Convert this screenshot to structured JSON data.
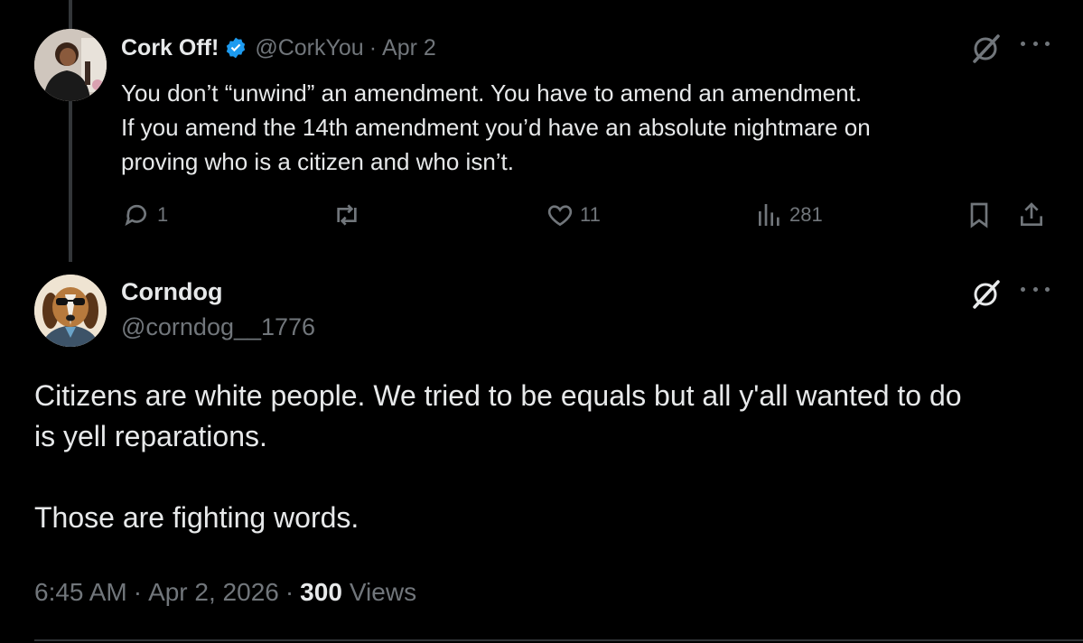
{
  "tweet_parent": {
    "display_name": "Cork Off!",
    "handle": "@CorkYou",
    "separator": "·",
    "date": "Apr 2",
    "body_lines": [
      "You don’t “unwind” an amendment. You have to amend an amendment.",
      "If you amend the 14th amendment you’d have an absolute nightmare on",
      "proving who is a citizen and who isn’t."
    ],
    "replies_count": "1",
    "likes_count": "11",
    "views_count": "281"
  },
  "tweet_main": {
    "display_name": "Corndog",
    "handle": "@corndog__1776",
    "body_lines": [
      "Citizens are white people. We tried to be equals but all y'all wanted to do",
      "is yell reparations."
    ],
    "body_last": "Those are fighting words.",
    "time": "6:45 AM",
    "separator": "·",
    "date": "Apr 2, 2026",
    "views_count": "300",
    "views_label": "Views"
  },
  "colors": {
    "background": "#000000",
    "text_primary": "#e7e9ea",
    "text_secondary": "#71767b",
    "verified_blue": "#1d9bf0",
    "thread_line": "#333639"
  },
  "icons": {
    "verified": "verified-badge-icon",
    "grok": "grok-icon",
    "more": "more-icon",
    "reply": "reply-icon",
    "retweet": "retweet-icon",
    "like": "like-icon",
    "views": "views-icon",
    "bookmark": "bookmark-icon",
    "share": "share-icon"
  }
}
